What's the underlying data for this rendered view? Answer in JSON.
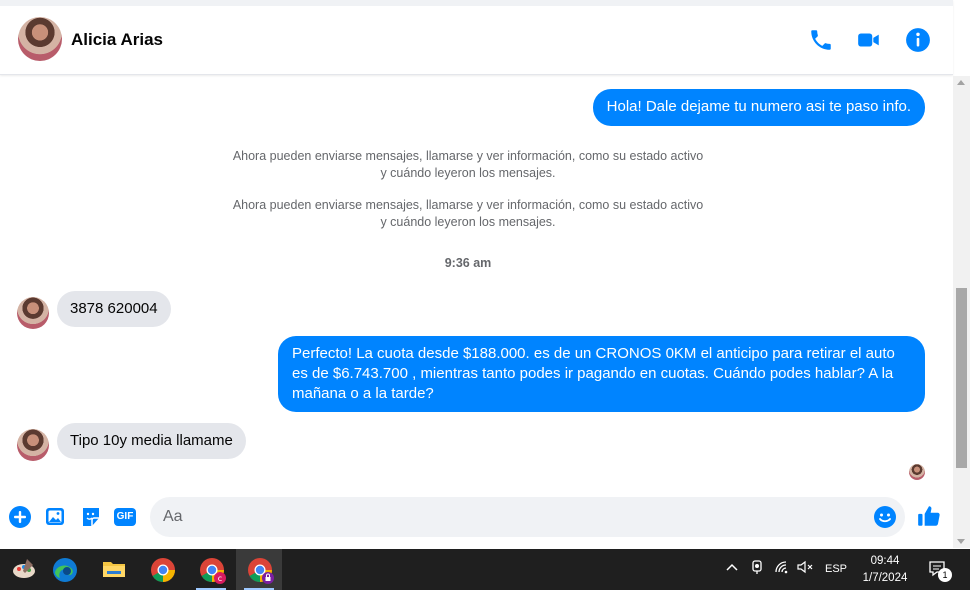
{
  "header": {
    "contact_name": "Alicia Arias",
    "icons": [
      "phone-icon",
      "video-camera-icon",
      "info-icon"
    ]
  },
  "conversation": {
    "messages": [
      {
        "direction": "out",
        "text": "Hola! Dale dejame tu numero  asi te paso info."
      },
      {
        "type": "system",
        "text": "Ahora pueden enviarse mensajes, llamarse y ver información, como su estado activo y cuándo leyeron los mensajes."
      },
      {
        "type": "system",
        "text": "Ahora pueden enviarse mensajes, llamarse y ver información, como su estado activo y cuándo leyeron los mensajes."
      },
      {
        "type": "timestamp",
        "text": "9:36 am"
      },
      {
        "direction": "in",
        "text": "3878 620004"
      },
      {
        "direction": "out",
        "text": "Perfecto! La cuota desde $188.000. es de un CRONOS 0KM el anticipo para retirar el auto es de $6.743.700 , mientras tanto podes ir pagando en cuotas. Cuándo podes hablar? A la mañana o a la tarde?"
      },
      {
        "direction": "in",
        "text": "Tipo 10y media llamame"
      }
    ]
  },
  "composer": {
    "placeholder": "Aa",
    "icons": [
      "plus-icon",
      "image-icon",
      "sticker-icon",
      "gif-icon",
      "emoji-icon",
      "thumbs-up-icon"
    ],
    "gif_label": "GIF"
  },
  "taskbar": {
    "apps": [
      "paint-app-icon",
      "edge-browser-icon",
      "file-explorer-icon",
      "chrome-icon",
      "chrome-profile-c-icon",
      "chrome-profile-lock-icon"
    ],
    "tray": {
      "language": "ESP",
      "time": "09:44",
      "date": "1/7/2024",
      "notification_count": "1"
    }
  },
  "colors": {
    "accent": "#0084ff",
    "incoming_bubble": "#e4e6eb",
    "secondary_text": "#65676b",
    "taskbar": "#1f1f1f"
  }
}
